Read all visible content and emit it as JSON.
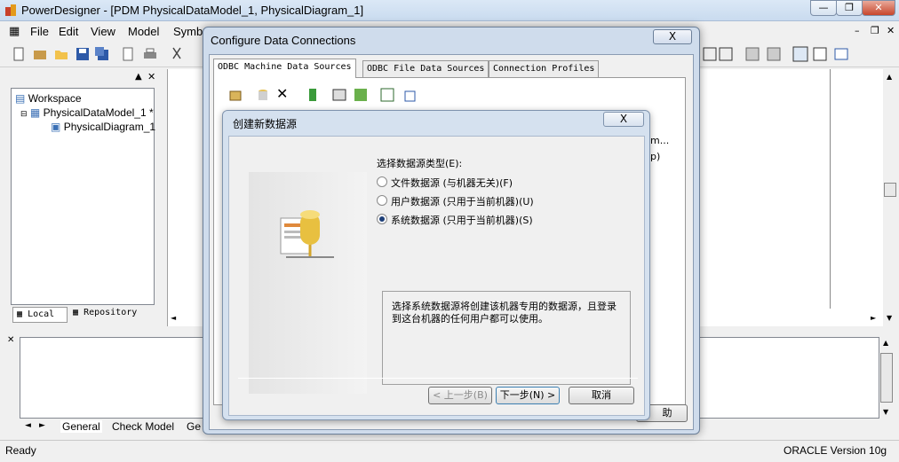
{
  "app": {
    "title": "PowerDesigner - [PDM PhysicalDataModel_1, PhysicalDiagram_1]"
  },
  "menu": [
    "File",
    "Edit",
    "View",
    "Model",
    "Symb"
  ],
  "browser": {
    "workspace": "Workspace",
    "model": "PhysicalDataModel_1 *",
    "diagram": "PhysicalDiagram_1",
    "tabs": [
      "Local",
      "Repository"
    ]
  },
  "output": {
    "tabs": [
      "General",
      "Check Model",
      "Ge"
    ]
  },
  "status": {
    "left": "Ready",
    "right": "ORACLE Version 10g"
  },
  "odbc": {
    "title": "Configure Data Connections",
    "close": "X",
    "tabs": [
      "ODBC Machine Data Sources",
      "ODBC File Data Sources",
      "Connection Profiles"
    ],
    "list_fragments": [
      "m...",
      "p)"
    ],
    "help_fragment": "助"
  },
  "wizard": {
    "title": "创建新数据源",
    "close": "X",
    "prompt": "选择数据源类型(E):",
    "options": [
      {
        "label": "文件数据源 (与机器无关)(F)",
        "selected": false
      },
      {
        "label": "用户数据源 (只用于当前机器)(U)",
        "selected": false
      },
      {
        "label": "系统数据源 (只用于当前机器)(S)",
        "selected": true
      }
    ],
    "description": "选择系统数据源将创建该机器专用的数据源，且登录到这台机器的任何用户都可以使用。",
    "buttons": {
      "back": "< 上一步(B)",
      "next": "下一步(N) >",
      "cancel": "取消"
    }
  }
}
